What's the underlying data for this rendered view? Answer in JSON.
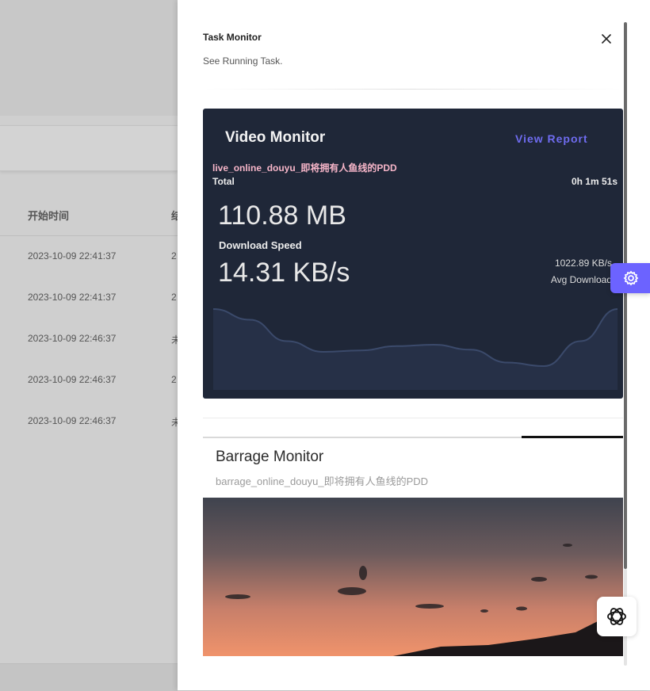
{
  "background": {
    "table": {
      "headers": [
        "开始时间",
        "结"
      ],
      "rows": [
        {
          "start": "2023-10-09 22:41:37",
          "col2": "2"
        },
        {
          "start": "2023-10-09 22:41:37",
          "col2": "2"
        },
        {
          "start": "2023-10-09 22:46:37",
          "col2": "未"
        },
        {
          "start": "2023-10-09 22:46:37",
          "col2": "2"
        },
        {
          "start": "2023-10-09 22:46:37",
          "col2": "未"
        }
      ]
    }
  },
  "drawer": {
    "title": "Task Monitor",
    "subtitle": "See Running Task.",
    "close_icon": "close-icon"
  },
  "video_monitor": {
    "title": "Video Monitor",
    "view_report": "View Report",
    "task_name": "live_online_douyu_即将拥有人鱼线的PDD",
    "total_label": "Total",
    "elapsed": "0h 1m 51s",
    "total_value": "110.88 MB",
    "speed_label": "Download Speed",
    "speed_value": "14.31 KB/s",
    "avg_value": "1022.89 KB/s",
    "avg_label": "Avg Download",
    "colors": {
      "card_bg": "#1f2738",
      "accent": "#6f6cf0",
      "task_name": "#f7b6c9",
      "line": "#3b4a6b"
    },
    "speed_series": [
      1.0,
      0.85,
      0.55,
      0.4,
      0.42,
      0.48,
      0.5,
      0.43,
      0.25,
      0.2,
      0.55,
      1.0
    ]
  },
  "barrage_monitor": {
    "title": "Barrage Monitor",
    "subtitle": "barrage_online_douyu_即将拥有人鱼线的PDD",
    "image": "sunset-photo"
  },
  "floating": {
    "settings_icon": "gear-icon",
    "assistant_icon": "openai-icon"
  }
}
